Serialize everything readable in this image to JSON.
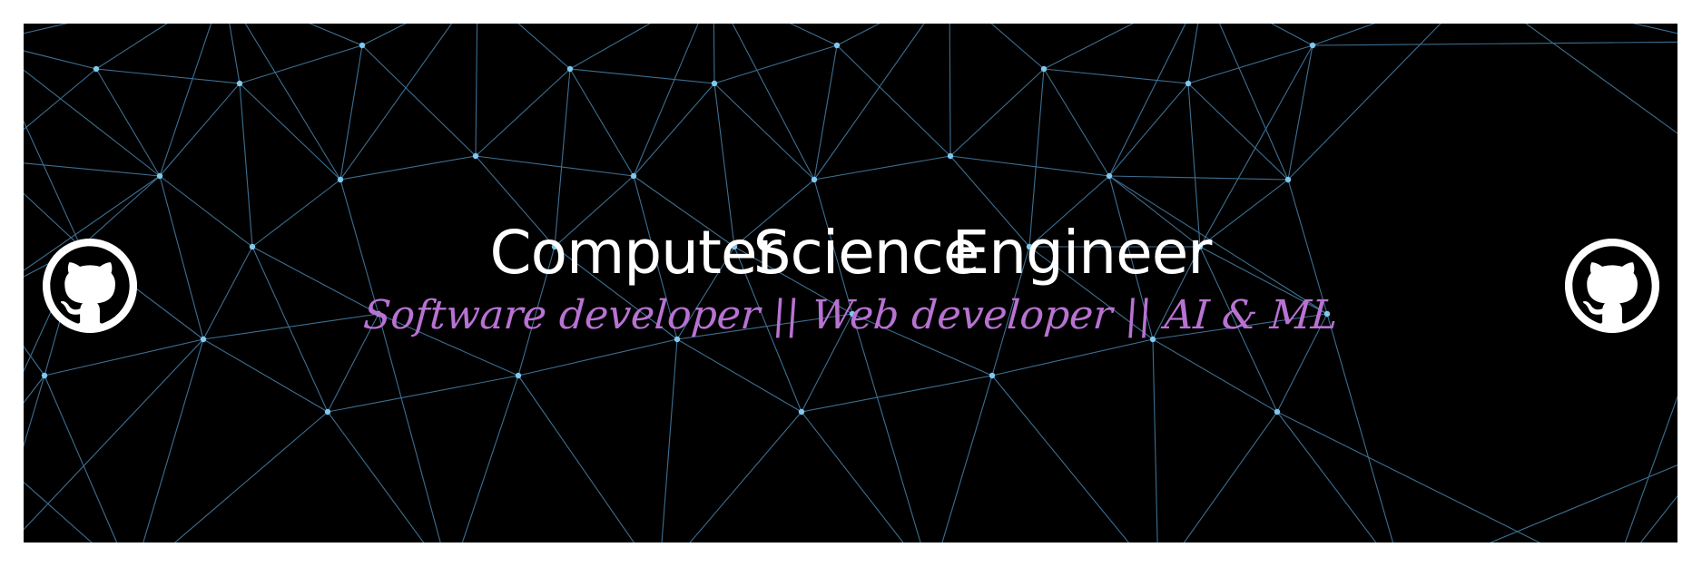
{
  "banner": {
    "title_words": [
      "Computer",
      "Science",
      "Engineer"
    ],
    "subtitle": "Software developer || Web developer || AI & ML",
    "icons": {
      "left": "github-icon",
      "right": "github-icon"
    },
    "colors": {
      "background": "#000000",
      "frame": "#ffffff",
      "network_line": "#3d6f92",
      "network_node": "#7fc8ee",
      "title": "#ffffff",
      "subtitle": "#b872d2"
    }
  }
}
